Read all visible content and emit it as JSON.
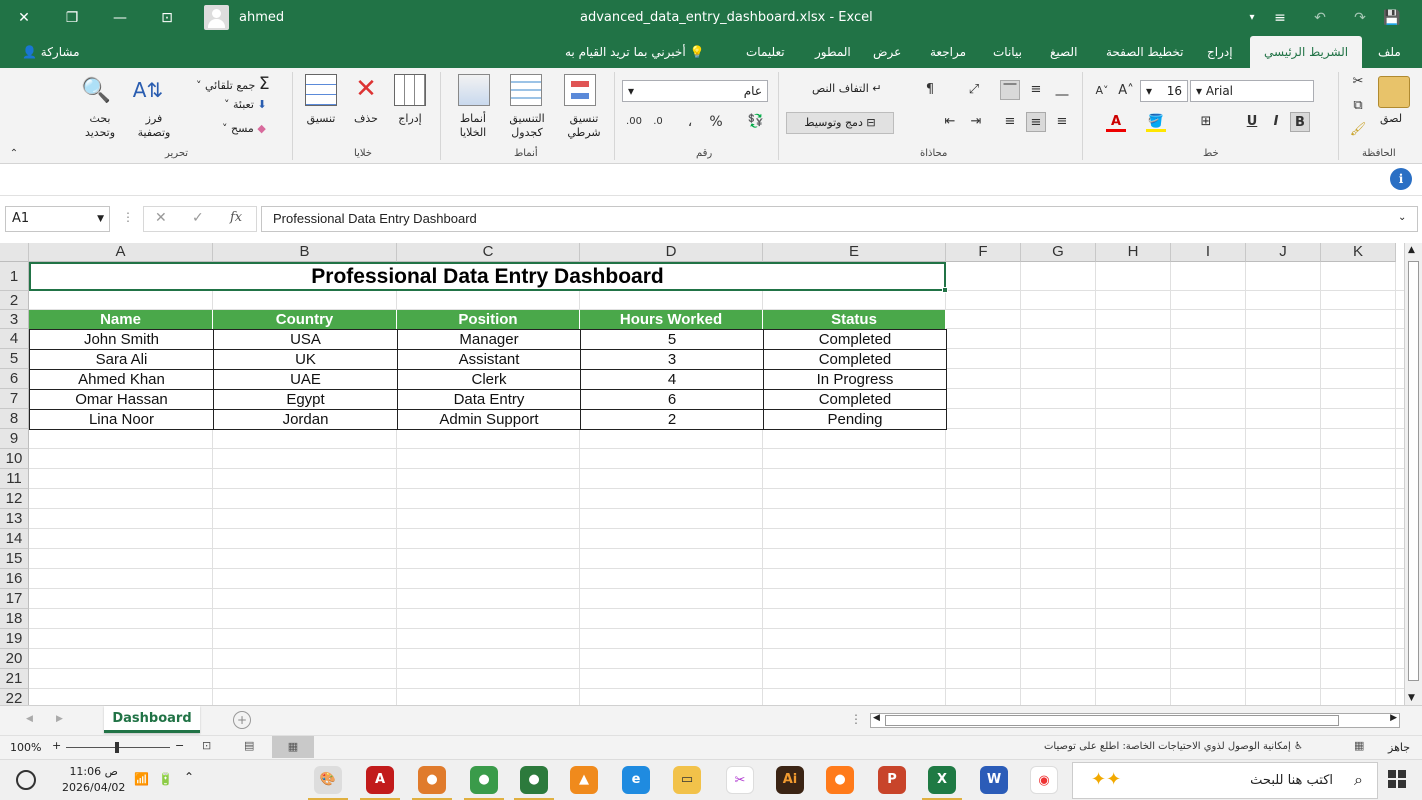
{
  "titlebar": {
    "user": "ahmed",
    "title": "advanced_data_entry_dashboard.xlsx  -  Excel"
  },
  "tabs": {
    "file": "ملف",
    "home": "الشريط الرئيسي",
    "insert": "إدراج",
    "page_layout": "تخطيط الصفحة",
    "formulas": "الصيغ",
    "data": "بيانات",
    "review": "مراجعة",
    "view": "عرض",
    "developer": "المطور",
    "help": "تعليمات",
    "tell_me": "أخبرني بما تريد القيام به",
    "share": "مشاركة"
  },
  "ribbon": {
    "clipboard": {
      "label": "الحافظة",
      "paste": "لصق"
    },
    "font": {
      "label": "خط",
      "name": "Arial",
      "size": "16",
      "bold": "B",
      "italic": "I",
      "underline": "U"
    },
    "alignment": {
      "label": "محاذاة",
      "wrap": "التفاف النص",
      "merge": "دمج وتوسيط"
    },
    "number": {
      "label": "رقم",
      "format": "عام",
      "percent": "%",
      "comma": "،",
      "inc_decimal": ".00",
      "dec_decimal": ".0"
    },
    "styles": {
      "label": "أنماط",
      "conditional": "تنسيق شرطي",
      "as_table": "التنسيق كجدول",
      "cell_styles": "أنماط الخلايا"
    },
    "cells": {
      "label": "خلايا",
      "insert": "إدراج",
      "delete": "حذف",
      "format": "تنسيق"
    },
    "editing": {
      "label": "تحرير",
      "autosum": "جمع تلقائي",
      "fill": "تعبئة",
      "clear": "مسح",
      "sort": "فرز وتصفية",
      "find": "بحث وتحديد"
    }
  },
  "formula_bar": {
    "name_box": "A1",
    "fx": "fx",
    "content": "Professional Data Entry Dashboard"
  },
  "grid": {
    "columns": [
      "A",
      "B",
      "C",
      "D",
      "E",
      "F",
      "G",
      "H",
      "I",
      "J",
      "K"
    ],
    "rows": [
      "1",
      "2",
      "3",
      "4",
      "5",
      "6",
      "7",
      "8",
      "9",
      "10",
      "11",
      "12",
      "13",
      "14",
      "15",
      "16",
      "17",
      "18",
      "19",
      "20",
      "21",
      "22"
    ],
    "title": "Professional Data Entry Dashboard",
    "headers": [
      "Name",
      "Country",
      "Position",
      "Hours Worked",
      "Status"
    ],
    "data": [
      [
        "John Smith",
        "USA",
        "Manager",
        "5",
        "Completed"
      ],
      [
        "Sara Ali",
        "UK",
        "Assistant",
        "3",
        "Completed"
      ],
      [
        "Ahmed Khan",
        "UAE",
        "Clerk",
        "4",
        "In Progress"
      ],
      [
        "Omar Hassan",
        "Egypt",
        "Data Entry",
        "6",
        "Completed"
      ],
      [
        "Lina Noor",
        "Jordan",
        "Admin Support",
        "2",
        "Pending"
      ]
    ]
  },
  "sheets": {
    "active": "Dashboard"
  },
  "status": {
    "ready": "جاهز",
    "accessibility": "إمكانية الوصول لذوي الاحتياجات الخاصة: اطلع على توصيات",
    "zoom": "100%"
  },
  "taskbar": {
    "search_placeholder": "اكتب هنا للبحث",
    "time": "11:06 ص",
    "date": "2026/04/02"
  },
  "colors": {
    "excel_green": "#217346",
    "header_green": "#4aa84a"
  }
}
